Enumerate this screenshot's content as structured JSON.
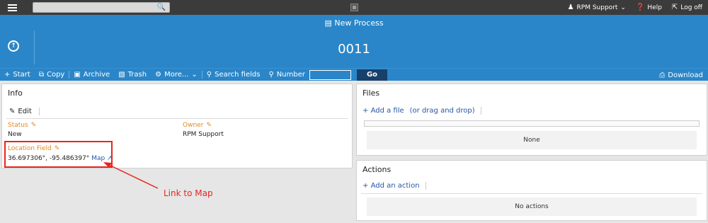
{
  "topbar": {
    "user_label": "RPM Support",
    "help_label": "Help",
    "logoff_label": "Log off",
    "icons": [
      "menu-icon",
      "search-icon",
      "user-icon",
      "chevron-down-icon",
      "help-icon",
      "logoff-icon"
    ]
  },
  "header": {
    "process_title": "New Process",
    "form_number": "0011"
  },
  "toolbar": {
    "start_label": "Start",
    "copy_label": "Copy",
    "archive_label": "Archive",
    "trash_label": "Trash",
    "more_label": "More...",
    "search_fields_label": "Search fields",
    "number_label": "Number",
    "number_value": "",
    "go_label": "Go",
    "download_label": "Download"
  },
  "info": {
    "title": "Info",
    "edit_label": "Edit",
    "status_label": "Status",
    "status_value": "New",
    "owner_label": "Owner",
    "owner_value": "RPM Support",
    "location_label": "Location Field",
    "location_value": "36.697306°, -95.486397°",
    "map_label": "Map"
  },
  "files": {
    "title": "Files",
    "add_file_label": "Add a file",
    "drag_hint": "(or drag and drop)",
    "empty_label": "None"
  },
  "actions": {
    "title": "Actions",
    "add_action_label": "Add an action",
    "empty_label": "No actions"
  },
  "annotation": {
    "text": "Link to Map",
    "color": "#e52620"
  },
  "colors": {
    "header_blue": "#2a86c8",
    "topbar_dark": "#3b3b3b",
    "field_label_orange": "#e3891d",
    "link_blue": "#2457a6"
  }
}
